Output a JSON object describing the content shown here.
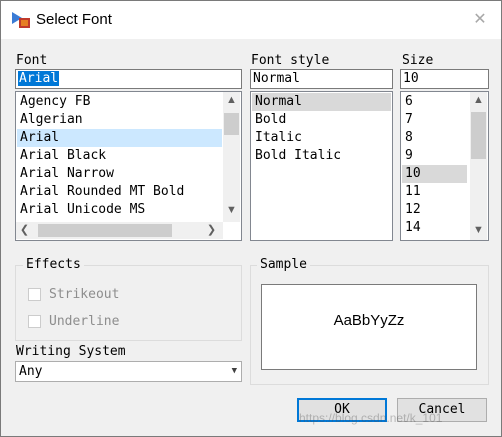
{
  "window": {
    "title": "Select Font",
    "close_glyph": "✕"
  },
  "font": {
    "label": "Font",
    "value": "Arial",
    "items": [
      "Agency FB",
      "Algerian",
      "Arial",
      "Arial Black",
      "Arial Narrow",
      "Arial Rounded MT Bold",
      "Arial Unicode MS"
    ],
    "selected": "Arial"
  },
  "font_style": {
    "label": "Font style",
    "value": "Normal",
    "items": [
      "Normal",
      "Bold",
      "Italic",
      "Bold Italic"
    ],
    "selected": "Normal"
  },
  "size": {
    "label": "Size",
    "value": "10",
    "items": [
      "6",
      "7",
      "8",
      "9",
      "10",
      "11",
      "12",
      "14"
    ],
    "selected": "10"
  },
  "effects": {
    "title": "Effects",
    "strikeout_label": "Strikeout",
    "underline_label": "Underline",
    "strikeout_checked": false,
    "underline_checked": false
  },
  "sample": {
    "title": "Sample",
    "text": "AaBbYyZz"
  },
  "writing_system": {
    "label": "Writing System",
    "value": "Any"
  },
  "buttons": {
    "ok": "OK",
    "cancel": "Cancel"
  },
  "watermark": "https://blog.csdn.net/k_101",
  "icons": {
    "up": "▲",
    "down": "▼",
    "left": "❮",
    "right": "❯"
  },
  "colors": {
    "selection_blue": "#cce8ff",
    "text_highlight": "#0078d7",
    "selection_grey": "#d9d9d9"
  }
}
